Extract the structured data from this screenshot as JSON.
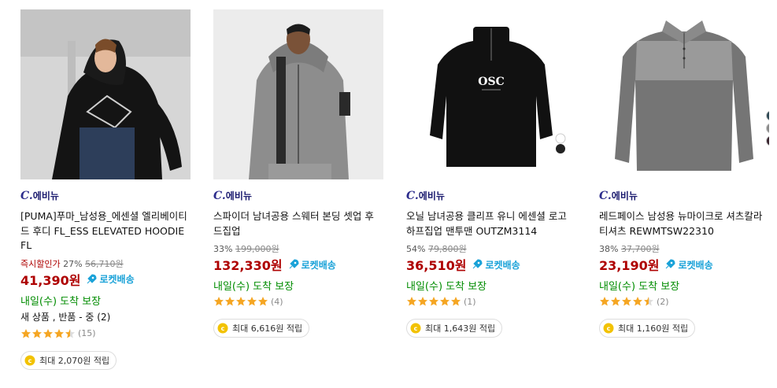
{
  "products": [
    {
      "brand": "에비뉴",
      "title": "[PUMA]푸마_남성용_에센셜 엘리베이티드 후디 FL_ESS ELEVATED HOODIE FL",
      "instant_label": "즉시할인가",
      "discount": "27%",
      "original_price": "56,710원",
      "price": "41,390원",
      "rocket": "로켓배송",
      "arrival": "내일(수) 도착 보장",
      "used": "새 상품 , 반품 - 중 (2)",
      "rating": 4.5,
      "review_count": "(15)",
      "reward": "최대 2,070원 적립",
      "image_icon": "hoodie-photo"
    },
    {
      "brand": "에비뉴",
      "title": "스파이더 남녀공용 스웨터 본딩 셋업 후드집업",
      "instant_label": "",
      "discount": "33%",
      "original_price": "199,000원",
      "price": "132,330원",
      "rocket": "로켓배송",
      "arrival": "내일(수) 도착 보장",
      "used": "",
      "rating": 5,
      "review_count": "(4)",
      "reward": "최대 6,616원 적립",
      "image_icon": "zip-hoodie-photo"
    },
    {
      "brand": "에비뉴",
      "title": "오닐 남녀공용 클리프 유니 에센셜 로고 하프집업 맨투맨 OUTZM3114",
      "instant_label": "",
      "discount": "54%",
      "original_price": "79,800원",
      "price": "36,510원",
      "rocket": "로켓배송",
      "arrival": "내일(수) 도착 보장",
      "used": "",
      "rating": 5,
      "review_count": "(1)",
      "reward": "최대 1,643원 적립",
      "image_icon": "half-zip-sweatshirt-photo",
      "logo_text": "OSC"
    },
    {
      "brand": "에비뉴",
      "title": "레드페이스 남성용 뉴마이크로 셔츠칼라 티셔츠 REWMTSW22310",
      "instant_label": "",
      "discount": "38%",
      "original_price": "37,700원",
      "price": "23,190원",
      "rocket": "로켓배송",
      "arrival": "내일(수) 도착 보장",
      "used": "",
      "rating": 4.5,
      "review_count": "(2)",
      "reward": "최대 1,160원 적립",
      "image_icon": "polo-shirt-photo"
    }
  ],
  "colors": {
    "price": "#ae0000",
    "rocket": "#1aa2d8",
    "arrival": "#008c00",
    "star": "#f5a623",
    "coin": "#f2c200",
    "brand": "#2c2c8c"
  }
}
